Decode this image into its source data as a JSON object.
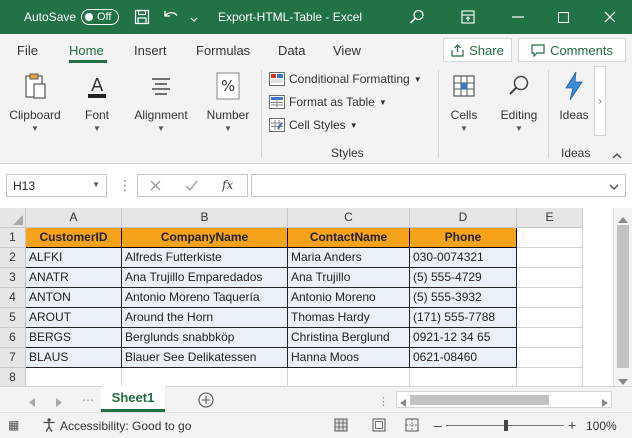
{
  "titlebar": {
    "autosave_label": "AutoSave",
    "autosave_state": "Off",
    "title": "Export-HTML-Table  -  Excel",
    "save_icon": "save-icon",
    "undo_icon": "undo-icon"
  },
  "menu": {
    "items": [
      "File",
      "Home",
      "Insert",
      "Formulas",
      "Data",
      "View"
    ],
    "active": "Home",
    "share_label": "Share",
    "comments_label": "Comments"
  },
  "ribbon": {
    "clipboard": "Clipboard",
    "font": "Font",
    "alignment": "Alignment",
    "number": "Number",
    "conditional_formatting": "Conditional Formatting",
    "format_as_table": "Format as Table",
    "cell_styles": "Cell Styles",
    "styles_group": "Styles",
    "cells": "Cells",
    "editing": "Editing",
    "ideas": "Ideas",
    "ideas_group": "Ideas"
  },
  "formula_bar": {
    "name_box": "H13",
    "formula": ""
  },
  "grid": {
    "columns": [
      "A",
      "B",
      "C",
      "D",
      "E"
    ],
    "rows": [
      "1",
      "2",
      "3",
      "4",
      "5",
      "6",
      "7",
      "8"
    ],
    "header": [
      "CustomerID",
      "CompanyName",
      "ContactName",
      "Phone"
    ],
    "data": [
      [
        "ALFKI",
        "Alfreds Futterkiste",
        "Maria Anders",
        "030-0074321"
      ],
      [
        "ANATR",
        "Ana Trujillo Emparedados",
        "Ana Trujillo",
        "(5) 555-4729"
      ],
      [
        "ANTON",
        "Antonio Moreno Taquería",
        "Antonio Moreno",
        "(5) 555-3932"
      ],
      [
        "AROUT",
        "Around the Horn",
        "Thomas Hardy",
        "(171) 555-7788"
      ],
      [
        "BERGS",
        "Berglunds snabbköp",
        "Christina Berglund",
        "0921-12 34 65"
      ],
      [
        "BLAUS",
        "Blauer See Delikatessen",
        "Hanna Moos",
        "0621-08460"
      ]
    ]
  },
  "sheets": {
    "active": "Sheet1"
  },
  "status": {
    "accessibility": "Accessibility: Good to go",
    "zoom": "100%"
  },
  "colors": {
    "brand": "#217346",
    "header_fill": "#f7a21b",
    "data_fill": "#eaf0f8"
  }
}
